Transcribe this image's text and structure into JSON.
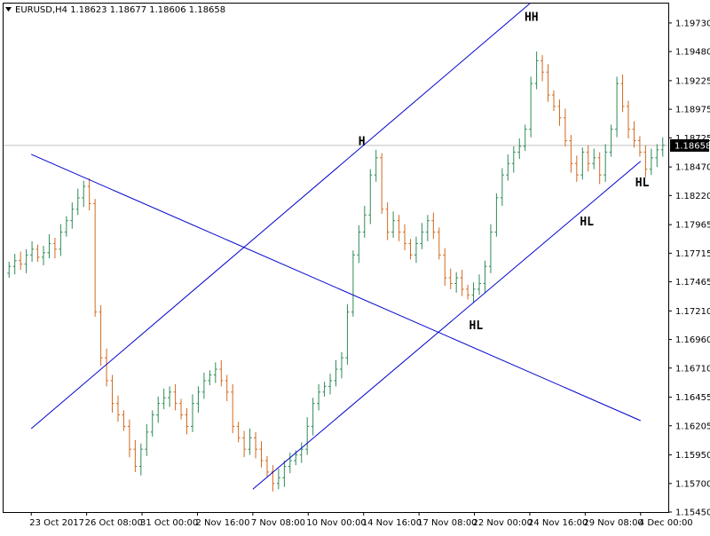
{
  "header": {
    "symbol_line": "EURUSD,H4  1.18623 1.18677 1.18606 1.18658",
    "menu_icon": "triangle-down-icon"
  },
  "colors": {
    "background": "#ffffff",
    "frame": "#000000",
    "bull_candle": "#2e8b57",
    "bear_candle": "#d2691e",
    "trendline": "#0000cd",
    "current_price_line": "#c0c0c0",
    "price_tag_bg": "#000000"
  },
  "chart_data": {
    "type": "line",
    "title": "EURUSD,H4  1.18623 1.18677 1.18606 1.18658",
    "xlabel": "",
    "ylabel": "",
    "ylim": [
      1.1545,
      1.199
    ],
    "grid": false,
    "y_ticks": [
      "1.19730",
      "1.19480",
      "1.19225",
      "1.18975",
      "1.18725",
      "1.18470",
      "1.18220",
      "1.17965",
      "1.17715",
      "1.17465",
      "1.17210",
      "1.16960",
      "1.16710",
      "1.16455",
      "1.16205",
      "1.15950",
      "1.15700",
      "1.15450"
    ],
    "x_ticks": [
      "23 Oct 2017",
      "26 Oct 08:00",
      "31 Oct 00:00",
      "2 Nov 16:00",
      "7 Nov 08:00",
      "10 Nov 00:00",
      "14 Nov 16:00",
      "17 Nov 08:00",
      "22 Nov 00:00",
      "24 Nov 16:00",
      "29 Nov 08:00",
      "4 Dec 00:00"
    ],
    "current_price": "1.18658",
    "series": [
      {
        "values": [
          1.176,
          1.1765,
          1.1762,
          1.177,
          1.1775,
          1.1768,
          1.1772,
          1.178,
          1.1775,
          1.179,
          1.18,
          1.181,
          1.182,
          1.183,
          1.1815,
          1.172,
          1.168,
          1.166,
          1.164,
          1.163,
          1.162,
          1.16,
          1.1585,
          1.16,
          1.1615,
          1.163,
          1.164,
          1.1645,
          1.165,
          1.164,
          1.163,
          1.162,
          1.164,
          1.165,
          1.166,
          1.1665,
          1.167,
          1.166,
          1.165,
          1.162,
          1.161,
          1.16,
          1.161,
          1.16,
          1.159,
          1.158,
          1.157,
          1.1575,
          1.1585,
          1.159,
          1.1595,
          1.16,
          1.162,
          1.164,
          1.165,
          1.1655,
          1.166,
          1.167,
          1.168,
          1.172,
          1.177,
          1.179,
          1.1805,
          1.184,
          1.1855,
          1.181,
          1.179,
          1.18,
          1.179,
          1.178,
          1.177,
          1.178,
          1.179,
          1.18,
          1.179,
          1.177,
          1.175,
          1.1745,
          1.175,
          1.174,
          1.1735,
          1.174,
          1.1745,
          1.176,
          1.179,
          1.182,
          1.184,
          1.185,
          1.186,
          1.1865,
          1.188,
          1.192,
          1.194,
          1.193,
          1.191,
          1.19,
          1.189,
          1.187,
          1.185,
          1.184,
          1.186,
          1.185,
          1.1855,
          1.184,
          1.186,
          1.188,
          1.192,
          1.19,
          1.188,
          1.187,
          1.186,
          1.1845,
          1.1855,
          1.1862,
          1.1866
        ]
      }
    ],
    "trendlines": [
      {
        "from": [
          "23 Oct 2017",
          1.1618
        ],
        "to": [
          "24 Nov 16:00",
          1.199
        ]
      },
      {
        "from": [
          "7 Nov 08:00",
          1.1565
        ],
        "to": [
          "4 Dec 00:00",
          1.1852
        ]
      },
      {
        "from": [
          "23 Oct 2017",
          1.1858
        ],
        "to": [
          "4 Dec 00:00",
          1.1625
        ]
      }
    ],
    "annotations": [
      {
        "text": "HH",
        "x": "24 Nov 16:00",
        "y": 1.1975
      },
      {
        "text": "H",
        "x": "14 Nov 16:00",
        "y": 1.1866
      },
      {
        "text": "HL",
        "x": "22 Nov 00:00",
        "y": 1.1705
      },
      {
        "text": "HL",
        "x": "29 Nov 08:00",
        "y": 1.1796
      },
      {
        "text": "HL",
        "x": "4 Dec 00:00",
        "y": 1.183
      }
    ]
  }
}
